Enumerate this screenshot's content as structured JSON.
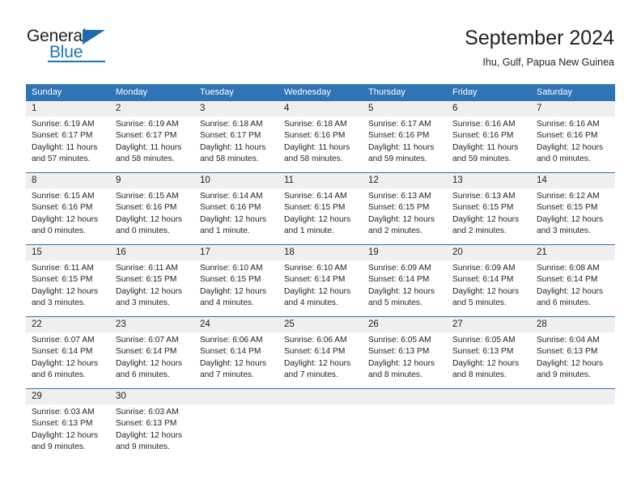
{
  "brand": {
    "word_one": "General",
    "word_two": "Blue",
    "accent_color": "#1a75bb",
    "triangle_color": "#1a6bb0",
    "logo_icon": "triangle-icon"
  },
  "header": {
    "title": "September 2024",
    "subtitle": "Ihu, Gulf, Papua New Guinea"
  },
  "calendar": {
    "header_bg": "#2f74b5",
    "header_text_color": "#ffffff",
    "daynum_bg": "#efefef",
    "weekdays": [
      "Sunday",
      "Monday",
      "Tuesday",
      "Wednesday",
      "Thursday",
      "Friday",
      "Saturday"
    ],
    "weeks": [
      {
        "days": [
          {
            "num": "1",
            "sunrise": "Sunrise: 6:19 AM",
            "sunset": "Sunset: 6:17 PM",
            "daylight_1": "Daylight: 11 hours",
            "daylight_2": "and 57 minutes."
          },
          {
            "num": "2",
            "sunrise": "Sunrise: 6:19 AM",
            "sunset": "Sunset: 6:17 PM",
            "daylight_1": "Daylight: 11 hours",
            "daylight_2": "and 58 minutes."
          },
          {
            "num": "3",
            "sunrise": "Sunrise: 6:18 AM",
            "sunset": "Sunset: 6:17 PM",
            "daylight_1": "Daylight: 11 hours",
            "daylight_2": "and 58 minutes."
          },
          {
            "num": "4",
            "sunrise": "Sunrise: 6:18 AM",
            "sunset": "Sunset: 6:16 PM",
            "daylight_1": "Daylight: 11 hours",
            "daylight_2": "and 58 minutes."
          },
          {
            "num": "5",
            "sunrise": "Sunrise: 6:17 AM",
            "sunset": "Sunset: 6:16 PM",
            "daylight_1": "Daylight: 11 hours",
            "daylight_2": "and 59 minutes."
          },
          {
            "num": "6",
            "sunrise": "Sunrise: 6:16 AM",
            "sunset": "Sunset: 6:16 PM",
            "daylight_1": "Daylight: 11 hours",
            "daylight_2": "and 59 minutes."
          },
          {
            "num": "7",
            "sunrise": "Sunrise: 6:16 AM",
            "sunset": "Sunset: 6:16 PM",
            "daylight_1": "Daylight: 12 hours",
            "daylight_2": "and 0 minutes."
          }
        ]
      },
      {
        "days": [
          {
            "num": "8",
            "sunrise": "Sunrise: 6:15 AM",
            "sunset": "Sunset: 6:16 PM",
            "daylight_1": "Daylight: 12 hours",
            "daylight_2": "and 0 minutes."
          },
          {
            "num": "9",
            "sunrise": "Sunrise: 6:15 AM",
            "sunset": "Sunset: 6:16 PM",
            "daylight_1": "Daylight: 12 hours",
            "daylight_2": "and 0 minutes."
          },
          {
            "num": "10",
            "sunrise": "Sunrise: 6:14 AM",
            "sunset": "Sunset: 6:16 PM",
            "daylight_1": "Daylight: 12 hours",
            "daylight_2": "and 1 minute."
          },
          {
            "num": "11",
            "sunrise": "Sunrise: 6:14 AM",
            "sunset": "Sunset: 6:15 PM",
            "daylight_1": "Daylight: 12 hours",
            "daylight_2": "and 1 minute."
          },
          {
            "num": "12",
            "sunrise": "Sunrise: 6:13 AM",
            "sunset": "Sunset: 6:15 PM",
            "daylight_1": "Daylight: 12 hours",
            "daylight_2": "and 2 minutes."
          },
          {
            "num": "13",
            "sunrise": "Sunrise: 6:13 AM",
            "sunset": "Sunset: 6:15 PM",
            "daylight_1": "Daylight: 12 hours",
            "daylight_2": "and 2 minutes."
          },
          {
            "num": "14",
            "sunrise": "Sunrise: 6:12 AM",
            "sunset": "Sunset: 6:15 PM",
            "daylight_1": "Daylight: 12 hours",
            "daylight_2": "and 3 minutes."
          }
        ]
      },
      {
        "days": [
          {
            "num": "15",
            "sunrise": "Sunrise: 6:11 AM",
            "sunset": "Sunset: 6:15 PM",
            "daylight_1": "Daylight: 12 hours",
            "daylight_2": "and 3 minutes."
          },
          {
            "num": "16",
            "sunrise": "Sunrise: 6:11 AM",
            "sunset": "Sunset: 6:15 PM",
            "daylight_1": "Daylight: 12 hours",
            "daylight_2": "and 3 minutes."
          },
          {
            "num": "17",
            "sunrise": "Sunrise: 6:10 AM",
            "sunset": "Sunset: 6:15 PM",
            "daylight_1": "Daylight: 12 hours",
            "daylight_2": "and 4 minutes."
          },
          {
            "num": "18",
            "sunrise": "Sunrise: 6:10 AM",
            "sunset": "Sunset: 6:14 PM",
            "daylight_1": "Daylight: 12 hours",
            "daylight_2": "and 4 minutes."
          },
          {
            "num": "19",
            "sunrise": "Sunrise: 6:09 AM",
            "sunset": "Sunset: 6:14 PM",
            "daylight_1": "Daylight: 12 hours",
            "daylight_2": "and 5 minutes."
          },
          {
            "num": "20",
            "sunrise": "Sunrise: 6:09 AM",
            "sunset": "Sunset: 6:14 PM",
            "daylight_1": "Daylight: 12 hours",
            "daylight_2": "and 5 minutes."
          },
          {
            "num": "21",
            "sunrise": "Sunrise: 6:08 AM",
            "sunset": "Sunset: 6:14 PM",
            "daylight_1": "Daylight: 12 hours",
            "daylight_2": "and 6 minutes."
          }
        ]
      },
      {
        "days": [
          {
            "num": "22",
            "sunrise": "Sunrise: 6:07 AM",
            "sunset": "Sunset: 6:14 PM",
            "daylight_1": "Daylight: 12 hours",
            "daylight_2": "and 6 minutes."
          },
          {
            "num": "23",
            "sunrise": "Sunrise: 6:07 AM",
            "sunset": "Sunset: 6:14 PM",
            "daylight_1": "Daylight: 12 hours",
            "daylight_2": "and 6 minutes."
          },
          {
            "num": "24",
            "sunrise": "Sunrise: 6:06 AM",
            "sunset": "Sunset: 6:14 PM",
            "daylight_1": "Daylight: 12 hours",
            "daylight_2": "and 7 minutes."
          },
          {
            "num": "25",
            "sunrise": "Sunrise: 6:06 AM",
            "sunset": "Sunset: 6:14 PM",
            "daylight_1": "Daylight: 12 hours",
            "daylight_2": "and 7 minutes."
          },
          {
            "num": "26",
            "sunrise": "Sunrise: 6:05 AM",
            "sunset": "Sunset: 6:13 PM",
            "daylight_1": "Daylight: 12 hours",
            "daylight_2": "and 8 minutes."
          },
          {
            "num": "27",
            "sunrise": "Sunrise: 6:05 AM",
            "sunset": "Sunset: 6:13 PM",
            "daylight_1": "Daylight: 12 hours",
            "daylight_2": "and 8 minutes."
          },
          {
            "num": "28",
            "sunrise": "Sunrise: 6:04 AM",
            "sunset": "Sunset: 6:13 PM",
            "daylight_1": "Daylight: 12 hours",
            "daylight_2": "and 9 minutes."
          }
        ]
      },
      {
        "days": [
          {
            "num": "29",
            "sunrise": "Sunrise: 6:03 AM",
            "sunset": "Sunset: 6:13 PM",
            "daylight_1": "Daylight: 12 hours",
            "daylight_2": "and 9 minutes."
          },
          {
            "num": "30",
            "sunrise": "Sunrise: 6:03 AM",
            "sunset": "Sunset: 6:13 PM",
            "daylight_1": "Daylight: 12 hours",
            "daylight_2": "and 9 minutes."
          },
          {
            "num": "",
            "sunrise": "",
            "sunset": "",
            "daylight_1": "",
            "daylight_2": ""
          },
          {
            "num": "",
            "sunrise": "",
            "sunset": "",
            "daylight_1": "",
            "daylight_2": ""
          },
          {
            "num": "",
            "sunrise": "",
            "sunset": "",
            "daylight_1": "",
            "daylight_2": ""
          },
          {
            "num": "",
            "sunrise": "",
            "sunset": "",
            "daylight_1": "",
            "daylight_2": ""
          },
          {
            "num": "",
            "sunrise": "",
            "sunset": "",
            "daylight_1": "",
            "daylight_2": ""
          }
        ]
      }
    ]
  }
}
